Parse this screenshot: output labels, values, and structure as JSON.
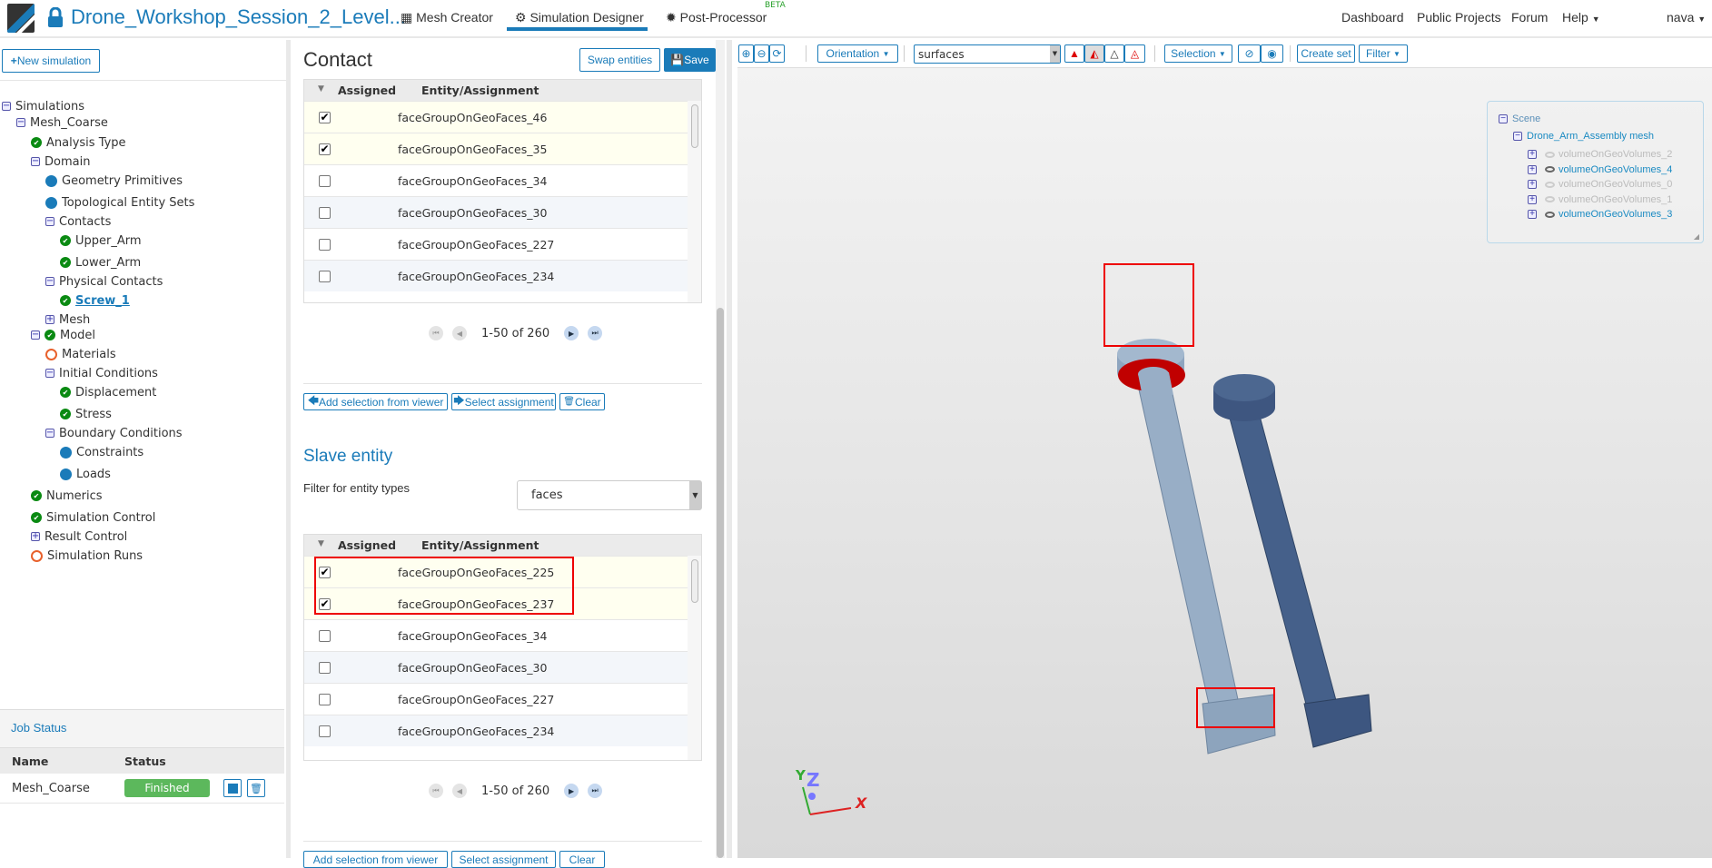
{
  "header": {
    "project_title": "Drone_Workshop_Session_2_Level...",
    "tabs": [
      {
        "label": "Mesh Creator"
      },
      {
        "label": "Simulation Designer",
        "active": true
      },
      {
        "label": "Post-Processor",
        "badge": "BETA"
      }
    ],
    "links": [
      "Dashboard",
      "Public Projects",
      "Forum",
      "Help"
    ],
    "user": "nava"
  },
  "left": {
    "new_simulation": "New simulation",
    "tree": [
      {
        "label": "Simulations",
        "icon": "minus",
        "level": 0
      },
      {
        "label": "Mesh_Coarse",
        "icon": "minus",
        "level": 1
      },
      {
        "label": "Analysis Type",
        "icon": "ok",
        "level": 2
      },
      {
        "label": "Domain",
        "icon": "minus",
        "level": 2
      },
      {
        "label": "Geometry Primitives",
        "icon": "dot",
        "level": 3
      },
      {
        "label": "Topological Entity Sets",
        "icon": "dot",
        "level": 3
      },
      {
        "label": "Contacts",
        "icon": "minus",
        "level": 3
      },
      {
        "label": "Upper_Arm",
        "icon": "ok",
        "level": 4
      },
      {
        "label": "Lower_Arm",
        "icon": "ok",
        "level": 4
      },
      {
        "label": "Physical Contacts",
        "icon": "minus",
        "level": 3
      },
      {
        "label": "Screw_1",
        "icon": "ok",
        "level": 4,
        "active": true
      },
      {
        "label": "Mesh",
        "icon": "plus",
        "level": 3
      },
      {
        "label": "Model",
        "icon": "minus-ok",
        "level": 2
      },
      {
        "label": "Materials",
        "icon": "ring",
        "level": 3
      },
      {
        "label": "Initial Conditions",
        "icon": "minus",
        "level": 3
      },
      {
        "label": "Displacement",
        "icon": "ok",
        "level": 4
      },
      {
        "label": "Stress",
        "icon": "ok",
        "level": 4
      },
      {
        "label": "Boundary Conditions",
        "icon": "minus",
        "level": 3
      },
      {
        "label": "Constraints",
        "icon": "dot",
        "level": 4
      },
      {
        "label": "Loads",
        "icon": "dot",
        "level": 4
      },
      {
        "label": "Numerics",
        "icon": "ok",
        "level": 2
      },
      {
        "label": "Simulation Control",
        "icon": "ok",
        "level": 2
      },
      {
        "label": "Result Control",
        "icon": "plus",
        "level": 2
      },
      {
        "label": "Simulation Runs",
        "icon": "ring",
        "level": 2
      }
    ],
    "job_status": {
      "title": "Job Status",
      "columns": [
        "Name",
        "Status"
      ],
      "rows": [
        {
          "name": "Mesh_Coarse",
          "status": "Finished"
        }
      ]
    }
  },
  "contact": {
    "title": "Contact",
    "swap": "Swap entities",
    "save": "Save",
    "columns": [
      "Assigned",
      "Entity/Assignment"
    ],
    "master_rows": [
      {
        "name": "faceGroupOnGeoFaces_46",
        "checked": true
      },
      {
        "name": "faceGroupOnGeoFaces_35",
        "checked": true
      },
      {
        "name": "faceGroupOnGeoFaces_34",
        "checked": false
      },
      {
        "name": "faceGroupOnGeoFaces_30",
        "checked": false
      },
      {
        "name": "faceGroupOnGeoFaces_227",
        "checked": false
      },
      {
        "name": "faceGroupOnGeoFaces_234",
        "checked": false
      }
    ],
    "pagination": "1-50 of 260",
    "actions": {
      "add": "Add selection from viewer",
      "select": "Select assignment",
      "clear": "Clear"
    },
    "slave_title": "Slave entity",
    "filter_label": "Filter for entity types",
    "filter_value": "faces",
    "slave_rows": [
      {
        "name": "faceGroupOnGeoFaces_225",
        "checked": true
      },
      {
        "name": "faceGroupOnGeoFaces_237",
        "checked": true
      },
      {
        "name": "faceGroupOnGeoFaces_34",
        "checked": false
      },
      {
        "name": "faceGroupOnGeoFaces_30",
        "checked": false
      },
      {
        "name": "faceGroupOnGeoFaces_227",
        "checked": false
      },
      {
        "name": "faceGroupOnGeoFaces_234",
        "checked": false
      }
    ],
    "slave_pagination": "1-50 of 260"
  },
  "viewer": {
    "orientation": "Orientation",
    "render_mode": "surfaces",
    "selection": "Selection",
    "create_set": "Create set",
    "filter": "Filter",
    "scene": {
      "root": "Scene",
      "mesh": "Drone_Arm_Assembly mesh",
      "volumes": [
        {
          "name": "volumeOnGeoVolumes_2",
          "visible": false
        },
        {
          "name": "volumeOnGeoVolumes_4",
          "visible": true
        },
        {
          "name": "volumeOnGeoVolumes_0",
          "visible": false
        },
        {
          "name": "volumeOnGeoVolumes_1",
          "visible": false
        },
        {
          "name": "volumeOnGeoVolumes_3",
          "visible": true
        }
      ]
    },
    "axes": {
      "x": "X",
      "y": "Y",
      "z": "Z"
    }
  },
  "colors": {
    "accent": "#1a7bb9",
    "highlight": "#c00000",
    "success": "#5cb85c"
  }
}
